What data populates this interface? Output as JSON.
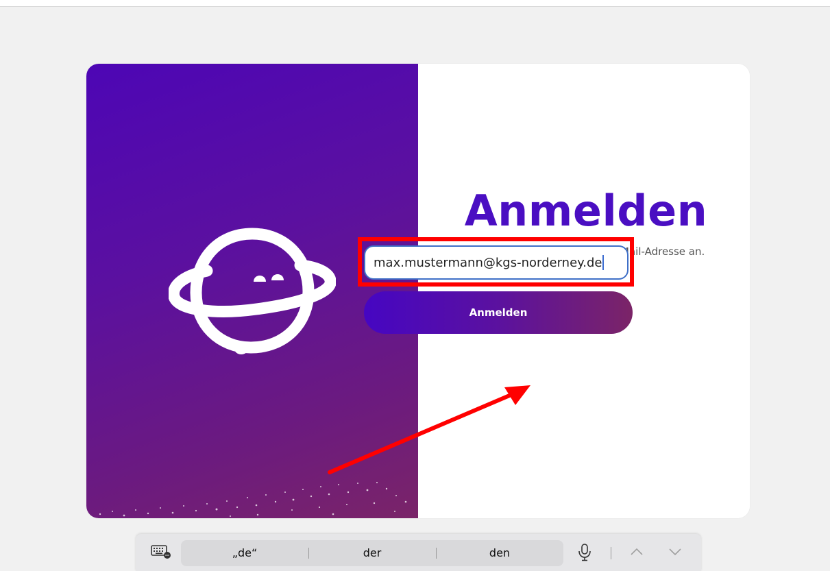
{
  "login": {
    "title": "Anmelden",
    "subtitle": "Melde dich mit deiner Schul-E-Mail-Adresse an.",
    "email_value": "max.mustermann@kgs-norderney.de",
    "button_label": "Anmelden"
  },
  "keyboard_bar": {
    "suggestions": [
      "„de“",
      "der",
      "den"
    ]
  },
  "colors": {
    "brand_purple": "#4a0ec2",
    "annotation_red": "#ff0000",
    "field_border": "#3f6fc7"
  },
  "icons": {
    "logo": "planet-face-logo",
    "keyboard": "keyboard-icon",
    "mic": "microphone-icon",
    "up": "chevron-up-icon",
    "down": "chevron-down-icon"
  }
}
